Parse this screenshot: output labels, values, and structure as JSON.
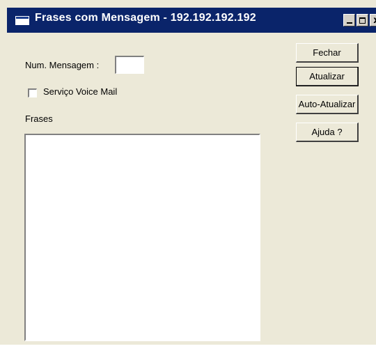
{
  "window": {
    "title": "Frases com Mensagem - 192.192.192.192",
    "controls": {
      "minimize": "_",
      "maximize": "□",
      "close": "x"
    }
  },
  "form": {
    "num_mensagem_label": "Num. Mensagem :",
    "num_mensagem_value": "",
    "voice_mail_label": "Serviço Voice Mail",
    "voice_mail_checked": false,
    "frases_label": "Frases",
    "frases_value": ""
  },
  "buttons": {
    "fechar": "Fechar",
    "atualizar": "Atualizar",
    "auto_atualizar": "Auto-Atualizar",
    "ajuda": "Ajuda ?"
  },
  "colors": {
    "titlebar": "#0a246a",
    "face": "#ece9d8"
  },
  "icons": [
    "window-app-icon",
    "minimize-icon",
    "maximize-icon",
    "close-icon"
  ]
}
